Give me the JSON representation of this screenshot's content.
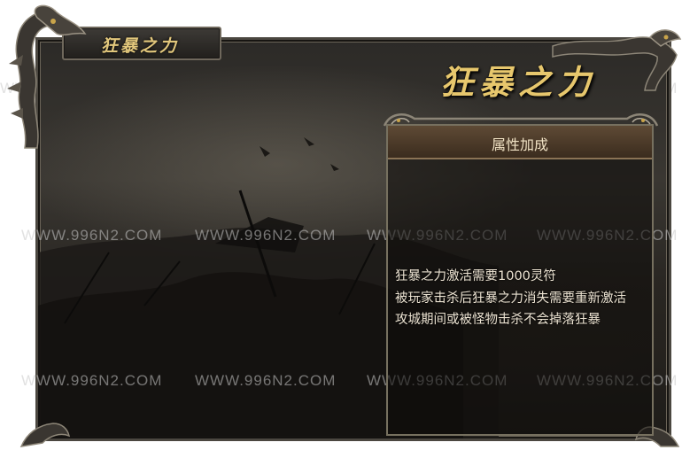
{
  "window": {
    "tab_title": "狂暴之力"
  },
  "content": {
    "heading": "狂暴之力",
    "attributes": {
      "header": "属性加成",
      "lines": [
        "狂暴之力激活需要1000灵符",
        "被玩家击杀后狂暴之力消失需要重新激活",
        "攻城期间或被怪物击杀不会掉落狂暴"
      ]
    }
  },
  "watermark": {
    "text": "WWW.996N2.COM"
  },
  "colors": {
    "gold": "#e7c76d",
    "frame": "#4b4740",
    "header_brown": "#4e3c2b",
    "body_text": "#ece3d2"
  },
  "icons": [
    "dragon-ornament-icon",
    "dragon-ornament-icon"
  ]
}
